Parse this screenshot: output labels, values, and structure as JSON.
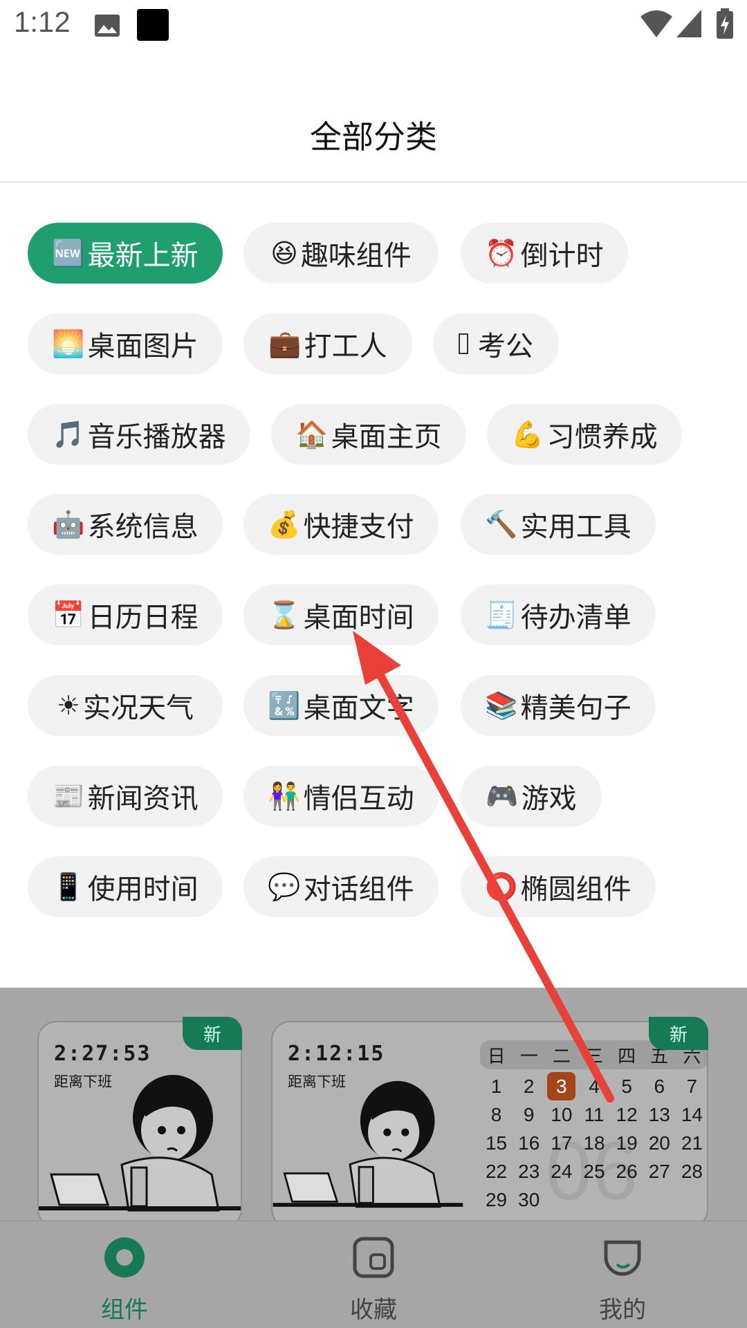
{
  "status_bar": {
    "time": "1:12"
  },
  "header": {
    "title": "全部分类"
  },
  "categories": [
    {
      "emoji": "🆕",
      "label": "最新上新"
    },
    {
      "emoji": "😆",
      "label": "趣味组件"
    },
    {
      "emoji": "⏰",
      "label": "倒计时"
    },
    {
      "emoji": "🌅",
      "label": "桌面图片"
    },
    {
      "emoji": "💼",
      "label": "打工人"
    },
    {
      "emoji": "",
      "label": "考公"
    },
    {
      "emoji": "🎵",
      "label": "音乐播放器"
    },
    {
      "emoji": "🏠",
      "label": "桌面主页"
    },
    {
      "emoji": "💪",
      "label": "习惯养成"
    },
    {
      "emoji": "🤖",
      "label": "系统信息"
    },
    {
      "emoji": "💰",
      "label": "快捷支付"
    },
    {
      "emoji": "🔨",
      "label": "实用工具"
    },
    {
      "emoji": "📅",
      "label": "日历日程"
    },
    {
      "emoji": "⌛",
      "label": "桌面时间"
    },
    {
      "emoji": "🧾",
      "label": "待办清单"
    },
    {
      "emoji": "☀",
      "label": "实况天气"
    },
    {
      "emoji": "🔣",
      "label": "桌面文字"
    },
    {
      "emoji": "📚",
      "label": "精美句子"
    },
    {
      "emoji": "📰",
      "label": "新闻资讯"
    },
    {
      "emoji": "👫",
      "label": "情侣互动"
    },
    {
      "emoji": "🎮",
      "label": "游戏"
    },
    {
      "emoji": "📱",
      "label": "使用时间"
    },
    {
      "emoji": "💬",
      "label": "对话组件"
    },
    {
      "emoji": "⭕",
      "label": "椭圆组件"
    }
  ],
  "preview": {
    "card1": {
      "time": "2:27:53",
      "subtitle": "距离下班",
      "badge": "新"
    },
    "card2": {
      "time": "2:12:15",
      "subtitle": "距离下班",
      "badge": "新"
    },
    "calendar": {
      "weekdays": [
        "日",
        "一",
        "二",
        "三",
        "四",
        "五",
        "六"
      ],
      "days": [
        "",
        "",
        "",
        "",
        "",
        "",
        "",
        "1",
        "2",
        "3",
        "4",
        "5",
        "6",
        "7",
        "8",
        "9",
        "10",
        "11",
        "12",
        "13",
        "14",
        "15",
        "16",
        "17",
        "18",
        "19",
        "20",
        "21",
        "22",
        "23",
        "24",
        "25",
        "26",
        "27",
        "28",
        "29",
        "30"
      ],
      "today": "3",
      "watermark": "06"
    }
  },
  "nav": {
    "tabs": [
      {
        "label": "组件",
        "icon": "widget-icon",
        "active": true
      },
      {
        "label": "收藏",
        "icon": "favorites-icon",
        "active": false
      },
      {
        "label": "我的",
        "icon": "profile-icon",
        "active": false
      }
    ]
  },
  "colors": {
    "accent": "#1f9e6e",
    "chip_bg": "#f2f2f2",
    "arrow": "#e8413a"
  }
}
